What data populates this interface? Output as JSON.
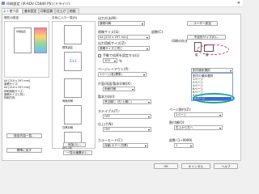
{
  "window": {
    "title": "印刷設定 (iR-ADV C5840 PS) (ドライバ)"
  },
  "tabs": [
    "よく使う設定",
    "基本設定",
    "印刷品質",
    "仕上げ",
    "給紙"
  ],
  "left": {
    "label": "現在の設定",
    "preset_label": "印刷設定",
    "summary_lines": [
      "A4 [210 x 297 mm]",
      "原稿サイズ:",
      "A4 [210 x 297 mm]",
      "印刷用紙サイズ:",
      "原稿サイズと同じ",
      "印刷方向:"
    ],
    "btn_view": "設定内容一覧...",
    "btn_restore": "標準に戻す"
  },
  "presets": {
    "label": "お気に入り一覧(R)",
    "items": [
      "標準設定",
      "2in1",
      "両面印刷",
      "白黒印刷",
      "割付2枚"
    ],
    "btn_add": "追加(1)...",
    "btn_edit": "一覧の編集(E)..."
  },
  "main": {
    "output_method_label": "出力方法(M):",
    "output_method_value": "通常印刷",
    "btn_custom": "ユーザー設定",
    "paper_size_label": "原稿サイズ(S):",
    "paper_size_value": "A4 [210 x 297 mm]",
    "output_size_label": "出力用紙サイズ(Z):",
    "output_size_value": "原稿サイズと同じ",
    "btn_custom_size": "不定形サイズ(E)...",
    "copies_label": "部数(C):",
    "copies_value": "1",
    "copies_unit": "[1~9999]",
    "orientation_label": "印刷の向き",
    "orient_portrait": "縦",
    "orient_landscape": "横",
    "zoom_check": "手動で倍率を設定する(L)",
    "zoom_value": "100",
    "zoom_unit": "%",
    "layout_label": "ページレイアウト(P):",
    "layout_value": "1ページ/枚(標準)",
    "duplex_label": "片面/両面/製本印刷(X):",
    "duplex_value": "両面印刷",
    "binding_label": "製本方向(I):",
    "binding_value": "長辺綴じ (左/上綴じ)",
    "staple_label": "ステイプル(T):",
    "staple_value": "OFF",
    "color_label": "カラーモード(C):",
    "color_value": "自動(カラー/白黒)",
    "finishing_label": "仕上げ(N):",
    "finishing_value": "OFF",
    "nup_label": "ページ割付(Z):",
    "nup_value": "1ページ",
    "direction_label": "割付順(O):",
    "direction_value": "右上から右へ",
    "zoom_count_label": "部数 (1~9999)",
    "zoom_count_value": "1"
  },
  "dropdown": {
    "header": "割付順序選択",
    "items": [
      "割付の順序選択",
      "1ページ",
      "2ページ",
      "4ページ",
      "6ページ",
      "8ページ",
      "9ページ",
      "16ページ"
    ],
    "selected": "16ページ"
  },
  "buttons": {
    "ok": "OK",
    "cancel": "キャンセル",
    "help": "ヘルプ"
  },
  "colors": {
    "accent": "#3a6ad4",
    "highlight_circle": "#1fa39a"
  }
}
